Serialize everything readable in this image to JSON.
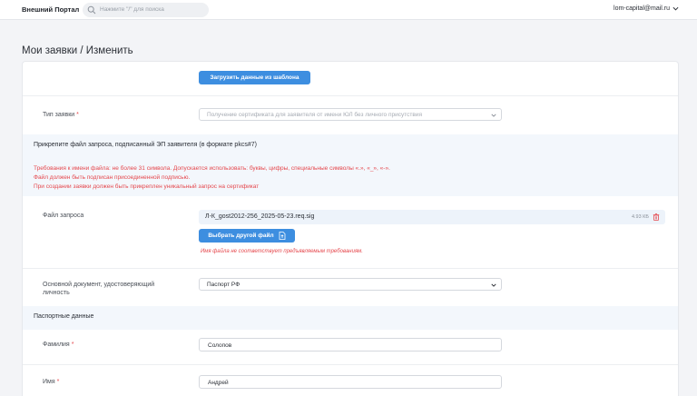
{
  "header": {
    "brand": "Внешний Портал",
    "search_placeholder": "Нажмите \"/\" для поиска",
    "user_email": "lom-capital@mail.ru"
  },
  "page": {
    "title": "Мои заявки / Изменить"
  },
  "form": {
    "template_button": "Загрузить данные из шаблона",
    "request_type": {
      "label": "Тип заявки",
      "required_mark": "*",
      "value": "Получение сертификата для заявителя от имени ЮЛ без личного присутствия"
    },
    "attach_section": {
      "title": "Прикрепите файл запроса, подписанный ЭП заявителя (в формате pkcs#7)",
      "requirements": [
        "Требования к имени файла: не более 31 символа. Допускается использовать: буквы, цифры, специальные символы «.», «_», «-».",
        "Файл должен быть подписан присоединенной подписью.",
        "При создании заявки должен быть прикреплен уникальный запрос на сертификат"
      ]
    },
    "request_file": {
      "label": "Файл запроса",
      "file_name": "Л-К_gost2012-256_2025-05-23.req.sig",
      "file_size": "4.93 КБ",
      "replace_button": "Выбрать другой файл",
      "error": "Имя файла не соответствует предъявляемым требованиям."
    },
    "identity_doc": {
      "label_line1": "Основной документ, удостоверяющий",
      "label_line2": "личность",
      "value": "Паспорт РФ"
    },
    "passport_section": {
      "title": "Паспортные данные"
    },
    "surname": {
      "label": "Фамилия",
      "required_mark": "*",
      "value": "Солопов"
    },
    "name": {
      "label": "Имя",
      "required_mark": "*",
      "value": "Андрей"
    }
  },
  "colors": {
    "accent": "#3d8ee0",
    "error": "#e5484d",
    "section_bg": "#f3f7fc"
  },
  "icons": [
    "search-icon",
    "chevron-down-icon",
    "trash-icon",
    "file-upload-icon"
  ]
}
